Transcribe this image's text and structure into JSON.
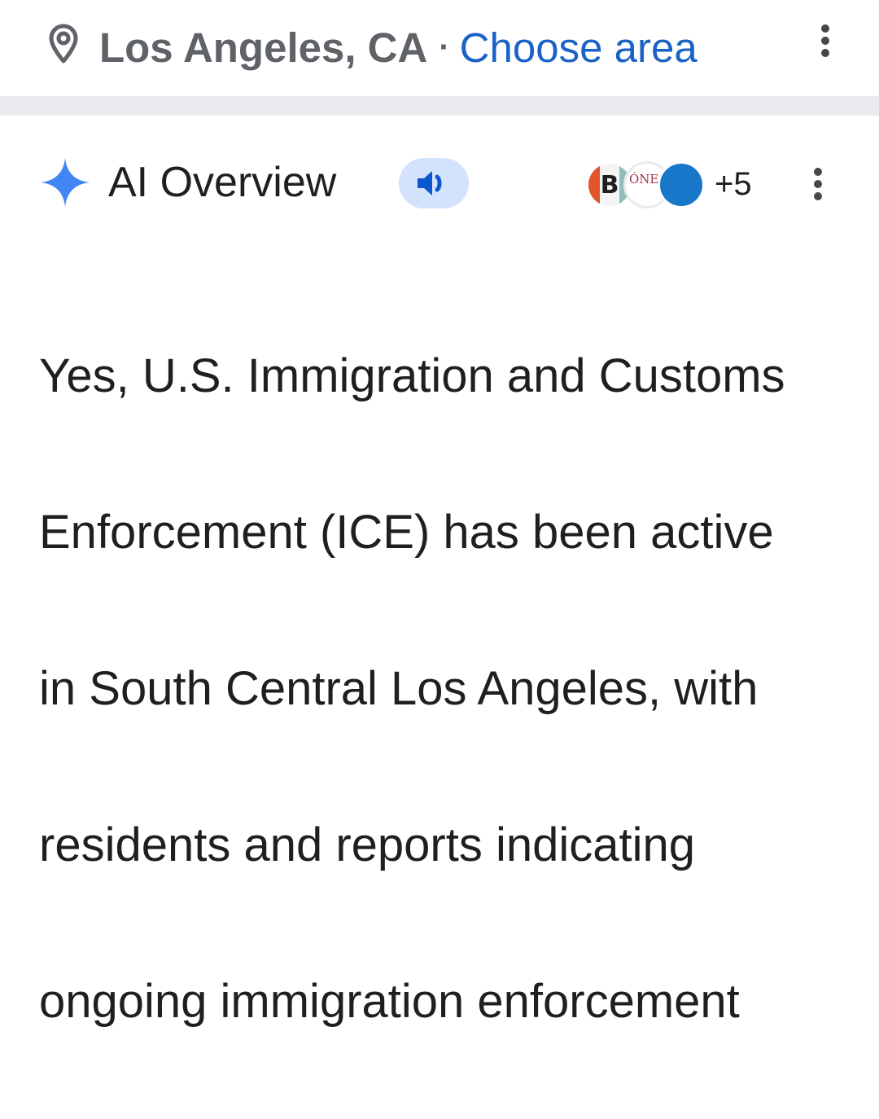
{
  "location": {
    "city": "Los Angeles, CA",
    "separator": "·",
    "choose_area_label": "Choose area",
    "pin_icon": "location-pin-icon",
    "menu_icon": "more-vert-icon"
  },
  "ai_overview": {
    "sparkle_icon": "gemini-sparkle-icon",
    "title": "AI Overview",
    "speaker_icon": "volume-icon",
    "sources": {
      "avatar_1_letter": "B",
      "avatar_2_text": "ÓNE",
      "more_count": "+5"
    },
    "menu_icon": "more-vert-icon",
    "answer_lines": [
      "Yes, U.S. Immigration and Customs",
      "Enforcement (ICE) has been active",
      "in South Central Los Angeles, with",
      "residents and reports indicating",
      "ongoing immigration enforcement"
    ]
  },
  "colors": {
    "link_blue": "#1a62c6",
    "speaker_bg": "#d3e3fd",
    "speaker_fg": "#0b57d0",
    "sparkle": "#4285f4",
    "divider": "#e8eaed",
    "text": "#1f1f1f",
    "muted": "#5f6368"
  }
}
